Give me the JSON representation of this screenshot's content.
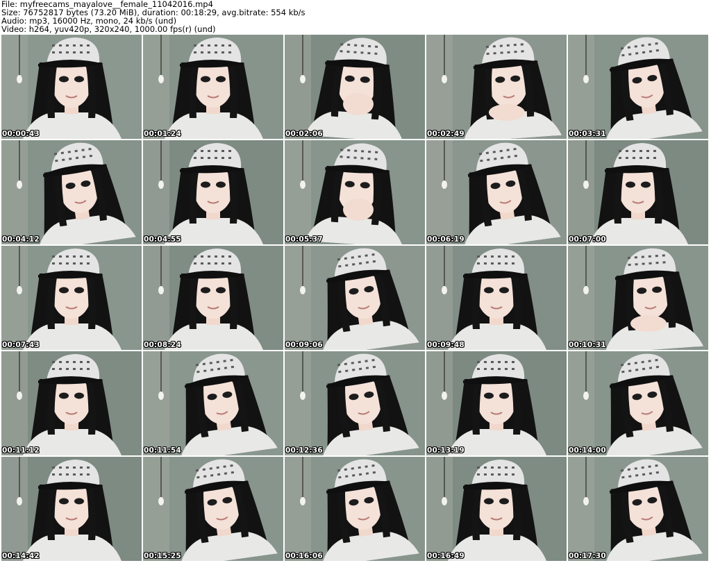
{
  "header": {
    "file_line": "File: myfreecams_mayalove__female_11042016.mp4",
    "size_line": "Size: 76752817 bytes (73.20 MiB), duration: 00:18:29, avg.bitrate: 554 kb/s",
    "audio_line": "Audio: mp3, 16000 Hz, mono, 24 kb/s (und)",
    "video_line": "Video: h264, yuv420p, 320x240, 1000.00 fps(r) (und)"
  },
  "thumbnails": [
    {
      "timestamp": "00:00:43",
      "pose": "front",
      "wall": "#8a9890"
    },
    {
      "timestamp": "00:01:24",
      "pose": "front",
      "wall": "#86948b"
    },
    {
      "timestamp": "00:02:06",
      "pose": "hand-mouth",
      "wall": "#7e8c84"
    },
    {
      "timestamp": "00:02:49",
      "pose": "chin-hand",
      "wall": "#8a968e"
    },
    {
      "timestamp": "00:03:31",
      "pose": "side",
      "wall": "#87958c"
    },
    {
      "timestamp": "00:04:12",
      "pose": "side",
      "wall": "#85938a"
    },
    {
      "timestamp": "00:04:55",
      "pose": "front",
      "wall": "#7d8b83"
    },
    {
      "timestamp": "00:05:37",
      "pose": "hand-mouth",
      "wall": "#87958c"
    },
    {
      "timestamp": "00:06:19",
      "pose": "side",
      "wall": "#8a968e"
    },
    {
      "timestamp": "00:07:00",
      "pose": "front",
      "wall": "#7c8a82"
    },
    {
      "timestamp": "00:07:43",
      "pose": "front",
      "wall": "#88968d"
    },
    {
      "timestamp": "00:08:24",
      "pose": "front",
      "wall": "#7f8d85"
    },
    {
      "timestamp": "00:09:06",
      "pose": "side",
      "wall": "#8b978f"
    },
    {
      "timestamp": "00:09:48",
      "pose": "front",
      "wall": "#828f88"
    },
    {
      "timestamp": "00:10:31",
      "pose": "chin-hand",
      "wall": "#88958d"
    },
    {
      "timestamp": "00:11:12",
      "pose": "front",
      "wall": "#7e8c84"
    },
    {
      "timestamp": "00:11:54",
      "pose": "side",
      "wall": "#8a978f"
    },
    {
      "timestamp": "00:12:36",
      "pose": "side",
      "wall": "#86948b"
    },
    {
      "timestamp": "00:13:19",
      "pose": "front",
      "wall": "#7c8a82"
    },
    {
      "timestamp": "00:14:00",
      "pose": "side",
      "wall": "#88958d"
    },
    {
      "timestamp": "00:14:42",
      "pose": "front",
      "wall": "#7d8b83"
    },
    {
      "timestamp": "00:15:25",
      "pose": "side",
      "wall": "#87958c"
    },
    {
      "timestamp": "00:16:06",
      "pose": "side",
      "wall": "#88958d"
    },
    {
      "timestamp": "00:16:49",
      "pose": "front",
      "wall": "#7e8c84"
    },
    {
      "timestamp": "00:17:30",
      "pose": "side",
      "wall": "#8a978f"
    }
  ]
}
